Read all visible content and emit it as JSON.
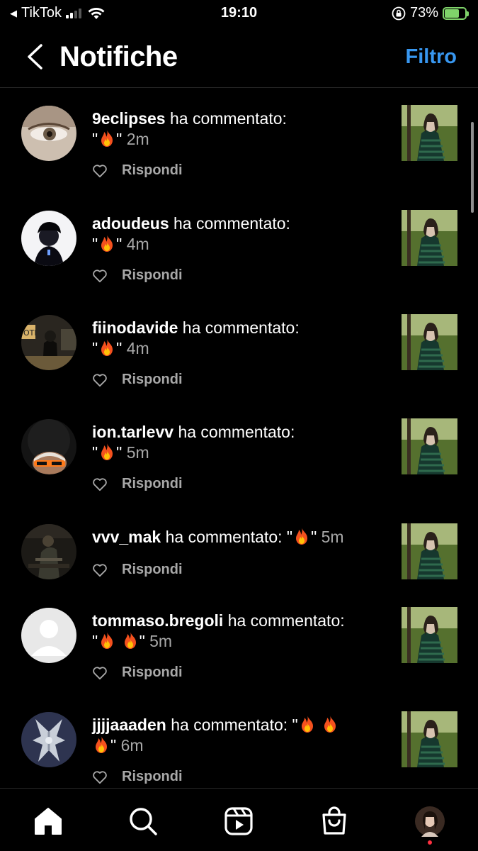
{
  "status_bar": {
    "carrier": "TikTok",
    "time": "19:10",
    "battery": "73%",
    "battery_level": 0.73
  },
  "header": {
    "title": "Notifiche",
    "filter_label": "Filtro"
  },
  "notifications": [
    {
      "username": "9eclipses",
      "action": "ha commentato:",
      "open_quote": "\"",
      "fires": 1,
      "close_quote": "\"",
      "time": "2m",
      "reply_label": "Rispondi"
    },
    {
      "username": "adoudeus",
      "action": "ha commentato:",
      "open_quote": "\"",
      "fires": 1,
      "close_quote": "\"",
      "time": "4m",
      "reply_label": "Rispondi"
    },
    {
      "username": "fiinodavide",
      "action": "ha commentato:",
      "open_quote": "\"",
      "fires": 1,
      "close_quote": "\"",
      "time": "4m",
      "reply_label": "Rispondi"
    },
    {
      "username": "ion.tarlevv",
      "action": "ha commentato:",
      "open_quote": "\"",
      "fires": 1,
      "close_quote": "\"",
      "time": "5m",
      "reply_label": "Rispondi"
    },
    {
      "username": "vvv_mak",
      "action": "ha commentato:",
      "open_quote": "\"",
      "fires": 1,
      "close_quote": "\"",
      "time": "5m",
      "reply_label": "Rispondi"
    },
    {
      "username": "tommaso.bregoli",
      "action": "ha commentato:",
      "open_quote": "\"",
      "fires": 2,
      "close_quote": "\"",
      "time": "5m",
      "reply_label": "Rispondi"
    },
    {
      "username": "jjjjaaaden",
      "action": "ha commentato:",
      "open_quote": "\"",
      "fires": 3,
      "close_quote": "\"",
      "time": "6m",
      "reply_label": "Rispondi"
    }
  ],
  "nav": {
    "items": [
      "home-icon",
      "search-icon",
      "reels-icon",
      "shop-icon",
      "profile-avatar"
    ],
    "notification_dot_color": "#ff3040"
  },
  "colors": {
    "accent": "#3897f0",
    "secondary_text": "#a8a8a8",
    "battery": "#7fd36a"
  }
}
